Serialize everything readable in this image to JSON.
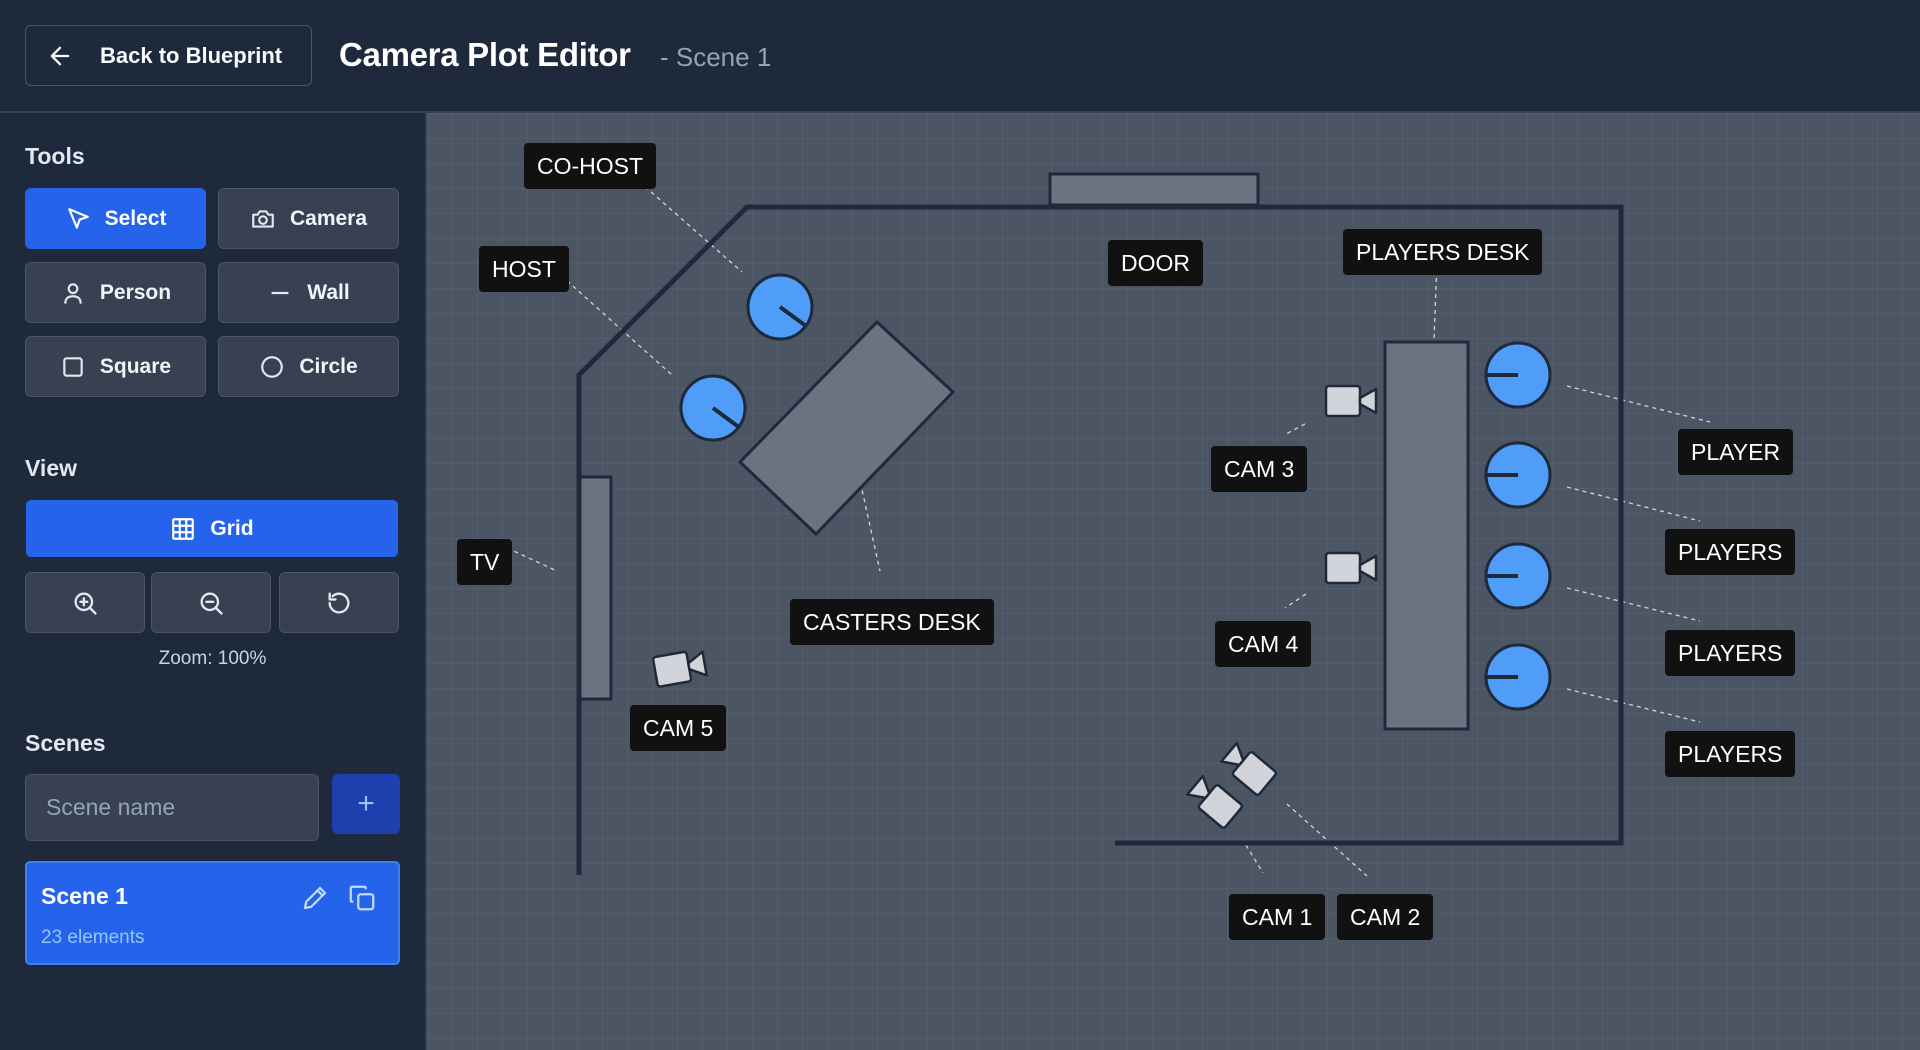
{
  "header": {
    "back_label": "Back to Blueprint",
    "title": "Camera Plot Editor",
    "subtitle": "- Scene 1"
  },
  "sidebar": {
    "tools_heading": "Tools",
    "tools": [
      {
        "label": "Select",
        "icon": "cursor-icon",
        "active": true
      },
      {
        "label": "Camera",
        "icon": "camera-icon"
      },
      {
        "label": "Person",
        "icon": "person-icon"
      },
      {
        "label": "Wall",
        "icon": "wall-line-icon"
      },
      {
        "label": "Square",
        "icon": "square-icon"
      },
      {
        "label": "Circle",
        "icon": "circle-icon"
      }
    ],
    "view_heading": "View",
    "grid_label": "Grid",
    "zoom_text": "Zoom: 100%",
    "scenes_heading": "Scenes",
    "scene_input_placeholder": "Scene name",
    "add_scene_label": "+",
    "scenes": [
      {
        "name": "Scene 1",
        "count": "23 elements",
        "active": true
      }
    ]
  },
  "canvas": {
    "labels": {
      "cohost": "CO-HOST",
      "host": "HOST",
      "door": "DOOR",
      "players_desk": "PLAYERS DESK",
      "cam3": "CAM 3",
      "player1": "PLAYER",
      "player2": "PLAYERS",
      "player3": "PLAYERS",
      "player4": "PLAYERS",
      "tv": "TV",
      "casters_desk": "CASTERS DESK",
      "cam4": "CAM 4",
      "cam5": "CAM 5",
      "cam1": "CAM 1",
      "cam2": "CAM 2"
    }
  },
  "colors": {
    "accent": "#2563eb",
    "person_fill": "#4f9cf9",
    "canvas_bg": "#4b5563",
    "furniture_fill": "#6b7280",
    "wall_stroke": "#1e293b",
    "label_bg": "#111111"
  }
}
